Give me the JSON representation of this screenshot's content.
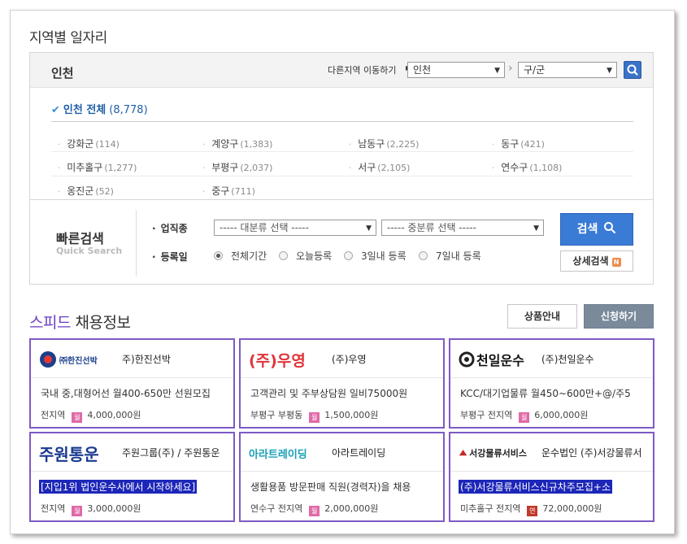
{
  "section_title": "지역별 일자리",
  "region": {
    "name": "인천",
    "move_label": "다른지역 이동하기",
    "select_city": "인천",
    "select_district": "구/군",
    "all_label": "인천 전체",
    "all_count": "(8,778)",
    "districts": [
      {
        "name": "강화군",
        "count": "(114)"
      },
      {
        "name": "계양구",
        "count": "(1,383)"
      },
      {
        "name": "남동구",
        "count": "(2,225)"
      },
      {
        "name": "동구",
        "count": "(421)"
      },
      {
        "name": "미추홀구",
        "count": "(1,277)"
      },
      {
        "name": "부평구",
        "count": "(2,037)"
      },
      {
        "name": "서구",
        "count": "(2,105)"
      },
      {
        "name": "연수구",
        "count": "(1,108)"
      },
      {
        "name": "옹진군",
        "count": "(52)"
      },
      {
        "name": "중구",
        "count": "(711)"
      }
    ]
  },
  "quick_search": {
    "title": "빠른검색",
    "subtitle": "Quick Search",
    "job_label": "업직종",
    "date_label": "등록일",
    "major_select": "----- 대분류 선택 -----",
    "minor_select": "----- 중분류 선택 -----",
    "radios": [
      "전체기간",
      "오늘등록",
      "3일내 등록",
      "7일내 등록"
    ],
    "search_button": "검색",
    "detail_button": "상세검색",
    "new_badge": "N"
  },
  "speed": {
    "title_accent": "스피드",
    "title_rest": "채용정보",
    "product_button": "상품안내",
    "apply_button": "신청하기",
    "cards": [
      {
        "logo": "㈜한진선박",
        "company": "주)한진선박",
        "title": "국내 중,대형어선 월400-650만 선원모집",
        "location": "전지역",
        "pay_type": "월",
        "amount": "4,000,000원",
        "highlight": false
      },
      {
        "logo": "(주)우영",
        "company": "(주)우영",
        "title": "고객관리 및 주부상담원 일비75000원",
        "location": "부평구 부평동",
        "pay_type": "월",
        "amount": "1,500,000원",
        "highlight": false
      },
      {
        "logo": "천일운수",
        "company": "(주)천일운수",
        "title": "KCC/대기업물류 월450~600만+@/주5",
        "location": "부평구 전지역",
        "pay_type": "월",
        "amount": "6,000,000원",
        "highlight": false
      },
      {
        "logo": "주원통운",
        "company": "주원그룹(주) / 주원통운",
        "title": "[지입1위 법인운수사에서 시작하세요]",
        "location": "전지역",
        "pay_type": "월",
        "amount": "3,000,000원",
        "highlight": true
      },
      {
        "logo": "아라트레이딩",
        "company": "아라트레이딩",
        "title": "생활용품 방문판매 직원(경력자)을 채용",
        "location": "연수구 전지역",
        "pay_type": "월",
        "amount": "2,000,000원",
        "highlight": false
      },
      {
        "logo": "서강물류서비스",
        "company": "운수법인 (주)서강물류서",
        "title": "(주)서강물류서비스신규차주모집+소",
        "location": "미추홀구 전지역",
        "pay_type": "연",
        "amount": "72,000,000원",
        "highlight": true
      }
    ]
  },
  "colors": {
    "accent_purple": "#6b3ec4",
    "card_border": "#7e5ac6",
    "search_blue": "#3a7bd5",
    "highlight": "#1c26b8"
  }
}
